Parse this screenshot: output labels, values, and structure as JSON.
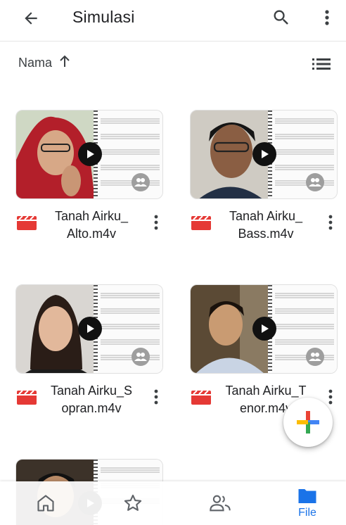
{
  "appbar": {
    "title": "Simulasi",
    "icons": {
      "back": "arrow-back-icon",
      "search": "search-icon",
      "menu": "more-vert-icon"
    }
  },
  "sort": {
    "label": "Nama",
    "direction_icon": "arrow-up-icon",
    "view_icon": "list-view-icon"
  },
  "files": [
    {
      "name_line1": "Tanah Airku_",
      "name_line2": "Alto.m4v",
      "type_icon": "video-file-icon",
      "shared_icon": "shared-people-icon"
    },
    {
      "name_line1": "Tanah Airku_",
      "name_line2": "Bass.m4v",
      "type_icon": "video-file-icon",
      "shared_icon": "shared-people-icon"
    },
    {
      "name_line1": "Tanah Airku_S",
      "name_line2": "opran.m4v",
      "type_icon": "video-file-icon",
      "shared_icon": "shared-people-icon"
    },
    {
      "name_line1": "Tanah Airku_T",
      "name_line2": "enor.m4v",
      "type_icon": "video-file-icon",
      "shared_icon": "shared-people-icon"
    }
  ],
  "fab": {
    "icon": "plus-icon",
    "colors": [
      "#ea4335",
      "#4285f4",
      "#34a853",
      "#fbbc04"
    ]
  },
  "bottom_nav": {
    "items": [
      {
        "icon": "home-icon",
        "label": ""
      },
      {
        "icon": "star-icon",
        "label": ""
      },
      {
        "icon": "shared-icon",
        "label": ""
      },
      {
        "icon": "folder-icon",
        "label": "File",
        "active": true
      }
    ],
    "active_color": "#1a73e8"
  }
}
